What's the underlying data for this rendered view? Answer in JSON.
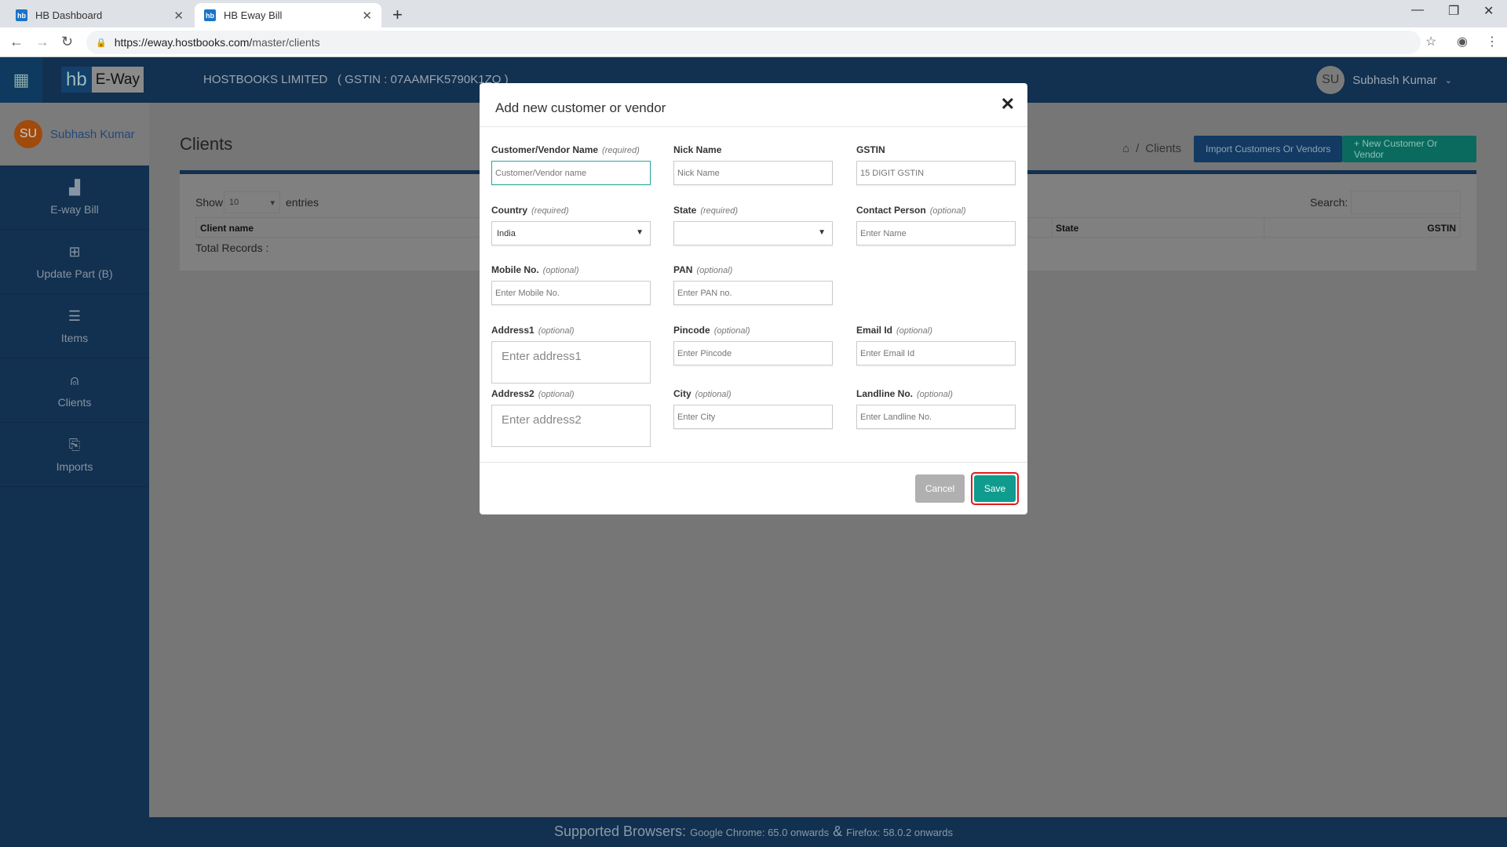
{
  "browser": {
    "tabs": [
      {
        "title": "HB Dashboard",
        "favicon": "hb"
      },
      {
        "title": "HB Eway Bill",
        "favicon": "hb"
      }
    ],
    "url_host": "https://eway.hostbooks.com/",
    "url_path": "master/clients"
  },
  "header": {
    "logo_hb": "hb",
    "logo_eway": "E-Way",
    "company": "HOSTBOOKS LIMITED",
    "gstin": "( GSTIN : 07AAMFK5790K1ZO )",
    "user_initials": "SU",
    "user_name": "Subhash Kumar"
  },
  "sidebar": {
    "user_initials": "SU",
    "user_name": "Subhash Kumar",
    "items": [
      {
        "label": "E-way Bill",
        "icon": "bar-chart-icon"
      },
      {
        "label": "Update Part (B)",
        "icon": "grid-icon"
      },
      {
        "label": "Items",
        "icon": "list-icon"
      },
      {
        "label": "Clients",
        "icon": "user-icon"
      },
      {
        "label": "Imports",
        "icon": "bookmark-icon"
      }
    ]
  },
  "page": {
    "title": "Clients",
    "breadcrumb": "Clients",
    "import_button": "Import Customers Or Vendors",
    "new_button": "+ New Customer Or Vendor",
    "show_label": "Show",
    "show_value": "10",
    "entries_label": "entries",
    "search_label": "Search:",
    "columns": [
      "Client name",
      "State",
      "GSTIN"
    ],
    "total_records": "Total Records :"
  },
  "modal": {
    "title": "Add new customer or vendor",
    "fields": {
      "name": {
        "label": "Customer/Vendor Name",
        "hint": "(required)",
        "placeholder": "Customer/Vendor name"
      },
      "nick": {
        "label": "Nick Name",
        "placeholder": "Nick Name"
      },
      "gstin": {
        "label": "GSTIN",
        "placeholder": "15 DIGIT GSTIN"
      },
      "country": {
        "label": "Country",
        "hint": "(required)",
        "value": "India"
      },
      "state": {
        "label": "State",
        "hint": "(required)",
        "value": ""
      },
      "contact": {
        "label": "Contact Person",
        "hint": "(optional)",
        "placeholder": "Enter Name"
      },
      "mobile": {
        "label": "Mobile No.",
        "hint": "(optional)",
        "placeholder": "Enter Mobile No."
      },
      "pan": {
        "label": "PAN",
        "hint": "(optional)",
        "placeholder": "Enter PAN no."
      },
      "address1": {
        "label": "Address1",
        "hint": "(optional)",
        "placeholder": "Enter address1"
      },
      "pincode": {
        "label": "Pincode",
        "hint": "(optional)",
        "placeholder": "Enter Pincode"
      },
      "email": {
        "label": "Email Id",
        "hint": "(optional)",
        "placeholder": "Enter Email Id"
      },
      "address2": {
        "label": "Address2",
        "hint": "(optional)",
        "placeholder": "Enter address2"
      },
      "city": {
        "label": "City",
        "hint": "(optional)",
        "placeholder": "Enter City"
      },
      "landline": {
        "label": "Landline No.",
        "hint": "(optional)",
        "placeholder": "Enter Landline No."
      }
    },
    "cancel": "Cancel",
    "save": "Save"
  },
  "footer": {
    "label": "Supported Browsers:",
    "detail1": "Google Chrome: 65.0 onwards",
    "amp": "&",
    "detail2": "Firefox: 58.0.2 onwards"
  },
  "colors": {
    "header": "#12304f",
    "accent_teal": "#0f9b8e",
    "save_highlight": "#e01b1b",
    "avatar": "#a04a0c"
  }
}
